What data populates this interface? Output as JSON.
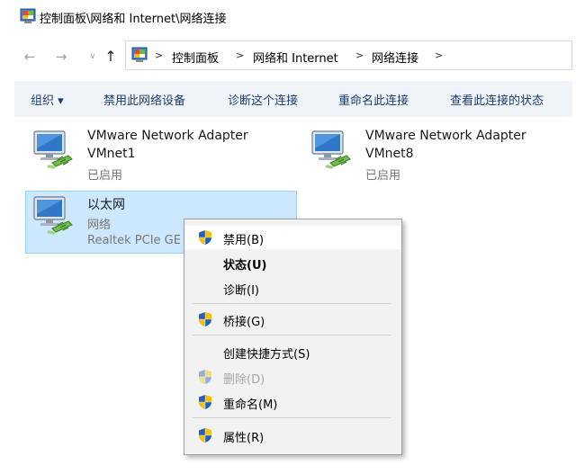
{
  "window": {
    "title": "控制面板\\网络和 Internet\\网络连接"
  },
  "address": {
    "crumbs": [
      "控制面板",
      "网络和 Internet",
      "网络连接"
    ]
  },
  "nav": {
    "back": "←",
    "forward": "→",
    "dropdown": "∨",
    "up": "↑",
    "sep": ">"
  },
  "toolbar": {
    "organize": "组织 ▾",
    "disable_device": "禁用此网络设备",
    "diagnose": "诊断这个连接",
    "rename": "重命名此连接",
    "view_status": "查看此连接的状态"
  },
  "adapters": [
    {
      "name1": "VMware Network Adapter",
      "name2": "VMnet1",
      "status": "已启用"
    },
    {
      "name1": "VMware Network Adapter",
      "name2": "VMnet8",
      "status": "已启用"
    },
    {
      "name1": "以太网",
      "name2": "网络",
      "status": "Realtek PCIe GE"
    }
  ],
  "context_menu": {
    "items": [
      {
        "label": "禁用(B)",
        "shield": true,
        "bold": false,
        "disabled": false
      },
      {
        "label": "状态(U)",
        "shield": false,
        "bold": true,
        "disabled": false
      },
      {
        "label": "诊断(I)",
        "shield": false,
        "bold": false,
        "disabled": false
      },
      {
        "label": "桥接(G)",
        "shield": true,
        "bold": false,
        "disabled": false
      },
      {
        "label": "创建快捷方式(S)",
        "shield": false,
        "bold": false,
        "disabled": false
      },
      {
        "label": "删除(D)",
        "shield": true,
        "bold": false,
        "disabled": true
      },
      {
        "label": "重命名(M)",
        "shield": true,
        "bold": false,
        "disabled": false
      },
      {
        "label": "属性(R)",
        "shield": true,
        "bold": false,
        "disabled": false
      }
    ]
  },
  "colors": {
    "selection_fill": "#cce8ff",
    "selection_border": "#99d1ff",
    "command_bar": "#f0f4f9",
    "command_text": "#1a3d6e",
    "shield_blue": "#1f5fbf",
    "shield_yellow": "#f4c20d"
  }
}
